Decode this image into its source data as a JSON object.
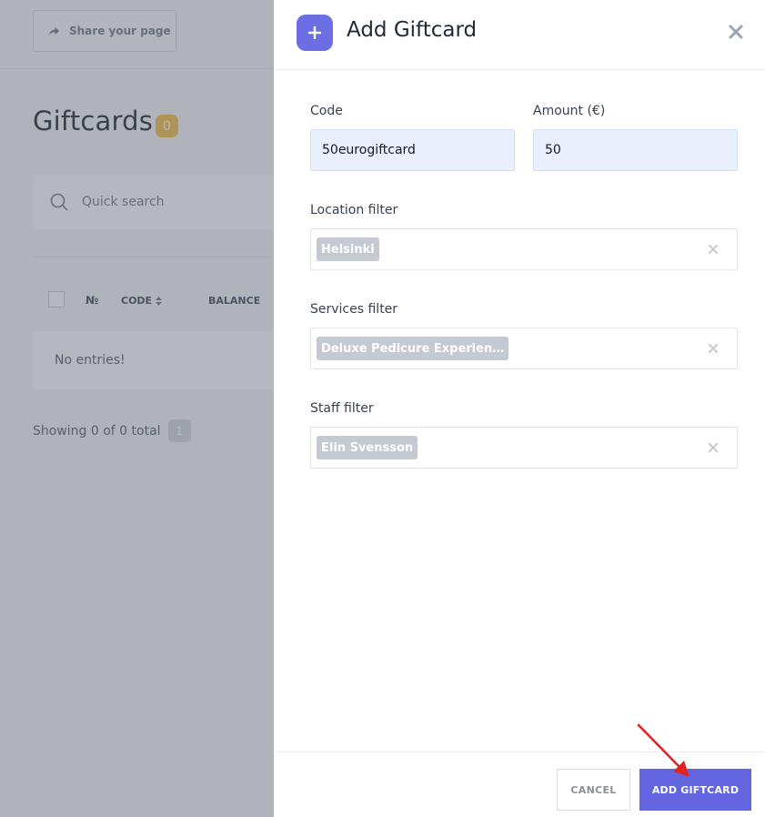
{
  "background": {
    "share_button": {
      "label": "Share your page",
      "icon": "share-arrow-icon"
    },
    "page_title": "Giftcards",
    "count_badge": "0",
    "search": {
      "placeholder": "Quick search",
      "icon": "search-icon"
    },
    "table": {
      "columns": [
        "№",
        "CODE",
        "BALANCE"
      ],
      "empty_message": "No entries!"
    },
    "footer": {
      "showing_text": "Showing 0 of 0 total",
      "page": "1"
    }
  },
  "drawer": {
    "title": "Add Giftcard",
    "icon": "plus-icon",
    "close_icon": "close-icon",
    "fields": {
      "code": {
        "label": "Code",
        "value": "50eurogiftcard"
      },
      "amount": {
        "label": "Amount (€)",
        "value": "50"
      },
      "location": {
        "label": "Location filter",
        "selected": "Helsinki"
      },
      "services": {
        "label": "Services filter",
        "selected": "Deluxe Pedicure Experien…"
      },
      "staff": {
        "label": "Staff filter",
        "selected": "Elin Svensson"
      }
    },
    "buttons": {
      "cancel": "CANCEL",
      "submit": "ADD GIFTCARD"
    }
  },
  "colors": {
    "accent": "#6366e0",
    "badge": "#f5b93a",
    "input_bg": "#e8effd",
    "chip": "#c5c9d2",
    "annotation_arrow": "#e02424"
  }
}
